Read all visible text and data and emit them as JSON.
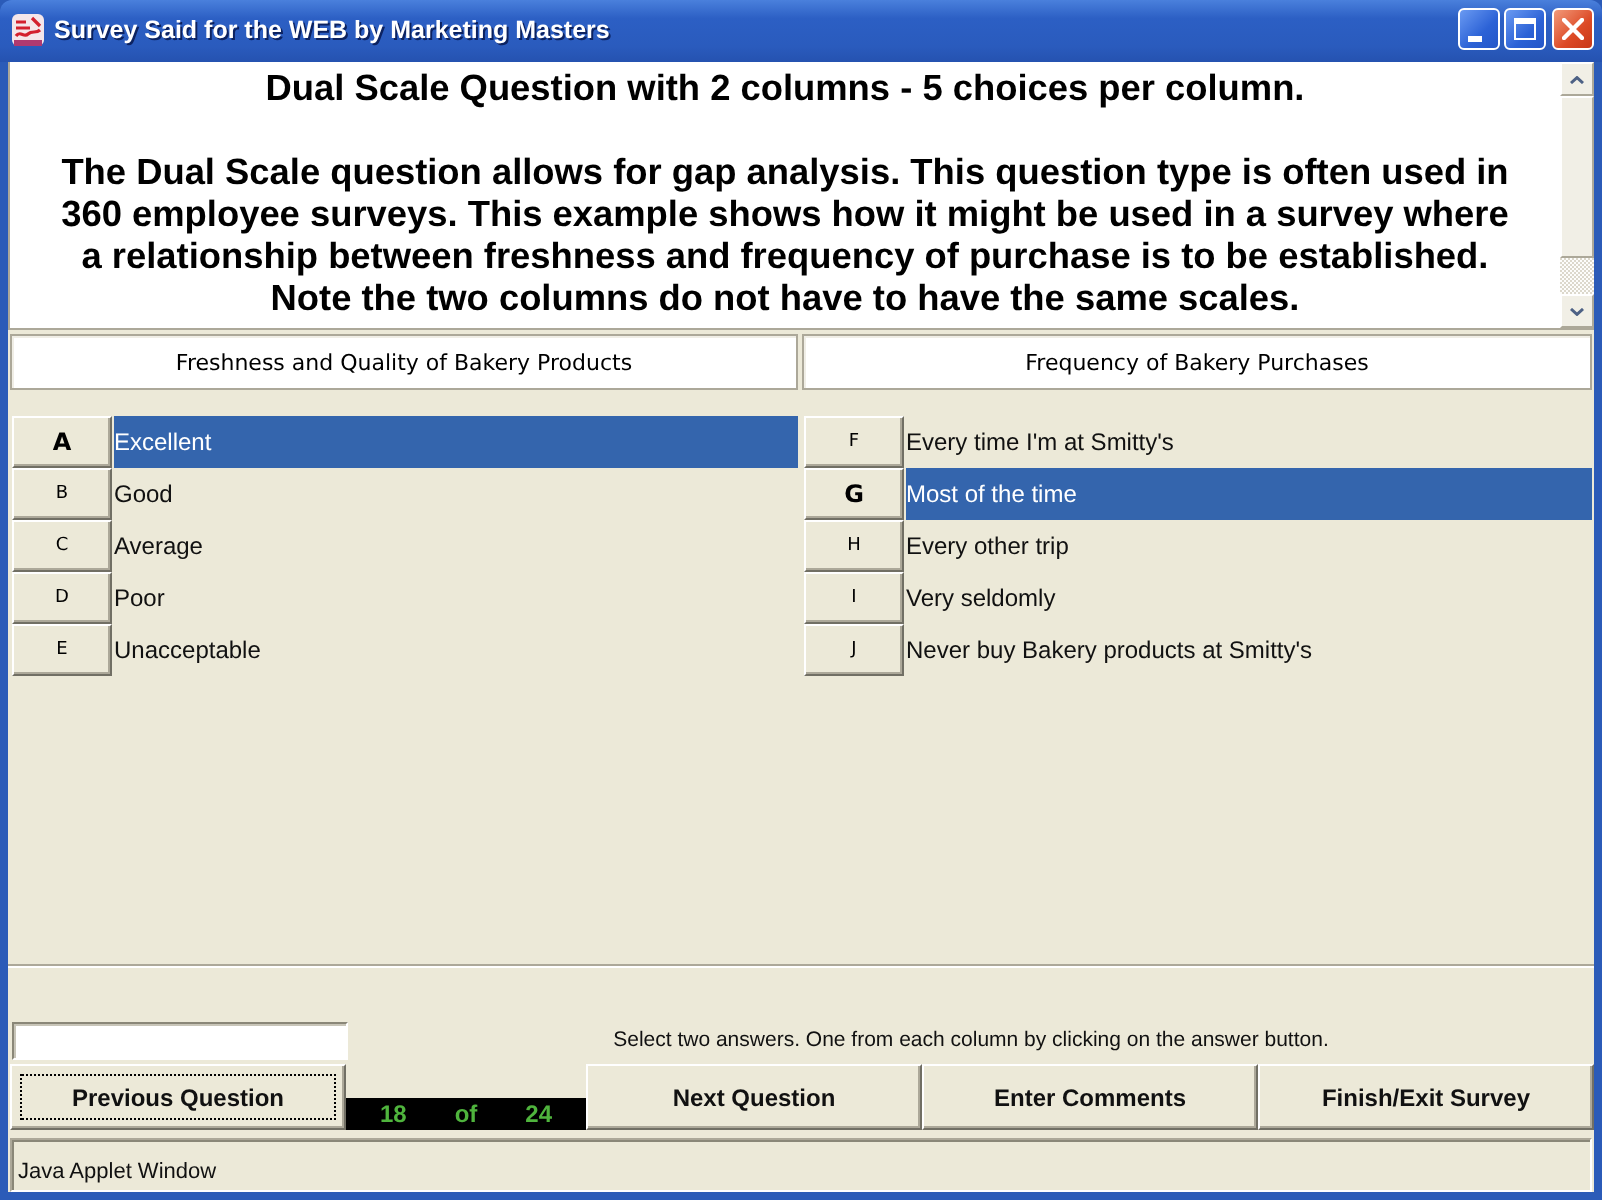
{
  "window": {
    "title": "Survey Said for the WEB by Marketing Masters"
  },
  "question": {
    "title": "Dual Scale Question with 2 columns - 5 choices per column.",
    "description": "The Dual Scale question allows for gap analysis. This question type is often used in 360 employee surveys. This example shows how it might be used in a survey where a relationship between freshness and frequency of purchase is to be established. Note the two columns do not have to have the same scales."
  },
  "columns": [
    {
      "heading": "Freshness and Quality of Bakery Products",
      "choices": [
        {
          "key": "A",
          "label": "Excellent",
          "selected": true
        },
        {
          "key": "B",
          "label": "Good",
          "selected": false
        },
        {
          "key": "C",
          "label": "Average",
          "selected": false
        },
        {
          "key": "D",
          "label": "Poor",
          "selected": false
        },
        {
          "key": "E",
          "label": "Unacceptable",
          "selected": false
        }
      ]
    },
    {
      "heading": "Frequency of Bakery Purchases",
      "choices": [
        {
          "key": "F",
          "label": "Every time I'm at Smitty's",
          "selected": false
        },
        {
          "key": "G",
          "label": "Most of the time",
          "selected": true
        },
        {
          "key": "H",
          "label": "Every other trip",
          "selected": false
        },
        {
          "key": "I",
          "label": "Very seldomly",
          "selected": false
        },
        {
          "key": "J",
          "label": "Never buy Bakery products at Smitty's",
          "selected": false
        }
      ]
    }
  ],
  "instruction": "Select two answers. One from each column by clicking on the answer button.",
  "navigation": [
    {
      "kind": "button",
      "label": "Previous Question",
      "focused": true
    },
    {
      "kind": "counter",
      "current": "18",
      "separator": "of",
      "total": "24"
    },
    {
      "kind": "button",
      "label": "Next Question",
      "focused": false
    },
    {
      "kind": "button",
      "label": "Enter Comments",
      "focused": false
    },
    {
      "kind": "button",
      "label": "Finish/Exit Survey",
      "focused": false
    }
  ],
  "status_bar": {
    "text": "Java Applet Window"
  }
}
